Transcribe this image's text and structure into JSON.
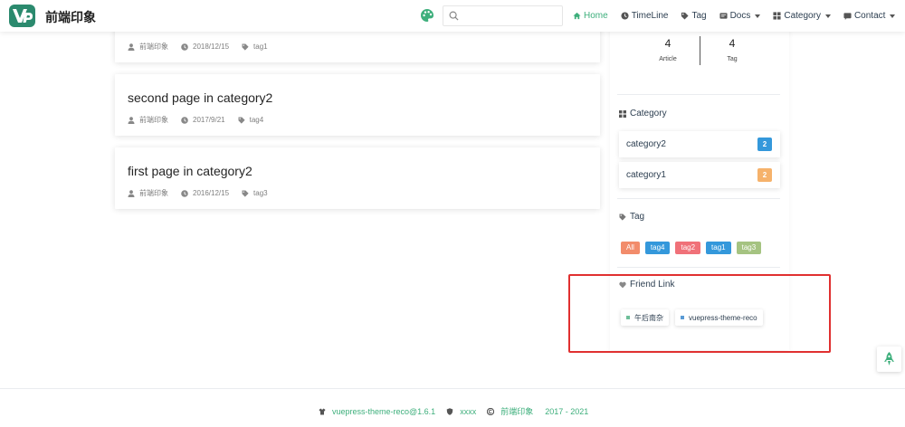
{
  "navbar": {
    "site_name": "前端印象",
    "search": {
      "value": "",
      "placeholder": ""
    },
    "links": [
      {
        "label": "Home",
        "icon": "home-icon",
        "active": true
      },
      {
        "label": "TimeLine",
        "icon": "clock-icon"
      },
      {
        "label": "Tag",
        "icon": "tag-icon"
      },
      {
        "label": "Docs",
        "icon": "doc-icon",
        "dropdown": true
      },
      {
        "label": "Category",
        "icon": "grid-icon",
        "dropdown": true
      },
      {
        "label": "Contact",
        "icon": "message-icon",
        "dropdown": true
      }
    ]
  },
  "articles": [
    {
      "title": "",
      "author": "前端印象",
      "date": "2018/12/15",
      "tag": "tag1"
    },
    {
      "title": "second page in category2",
      "author": "前端印象",
      "date": "2017/9/21",
      "tag": "tag4"
    },
    {
      "title": "first page in category2",
      "author": "前端印象",
      "date": "2016/12/15",
      "tag": "tag3"
    }
  ],
  "sidebar": {
    "stats": [
      {
        "num": "4",
        "label": "Article"
      },
      {
        "num": "4",
        "label": "Tag"
      }
    ],
    "category_heading": "Category",
    "categories": [
      {
        "name": "category2",
        "count": "2",
        "color": "#3498db"
      },
      {
        "name": "category1",
        "count": "2",
        "color": "#f6b26b"
      }
    ],
    "tag_heading": "Tag",
    "tags": [
      {
        "label": "All",
        "color": "#f28c6b"
      },
      {
        "label": "tag4",
        "color": "#3498db"
      },
      {
        "label": "tag2",
        "color": "#f07179"
      },
      {
        "label": "tag1",
        "color": "#3498db"
      },
      {
        "label": "tag3",
        "color": "#a5c381"
      }
    ],
    "friend_heading": "Friend Link",
    "friend_links": [
      {
        "label": "午后南杂",
        "color": "#6fbf9a"
      },
      {
        "label": "vuepress-theme-reco",
        "color": "#5a9bd5"
      }
    ]
  },
  "footer": {
    "theme": "vuepress-theme-reco@1.6.1",
    "icp": "xxxx",
    "author": "前端印象",
    "years": "2017 - 2021"
  },
  "colors": {
    "accent": "#3eaf7c",
    "highlight": "#e03030"
  }
}
